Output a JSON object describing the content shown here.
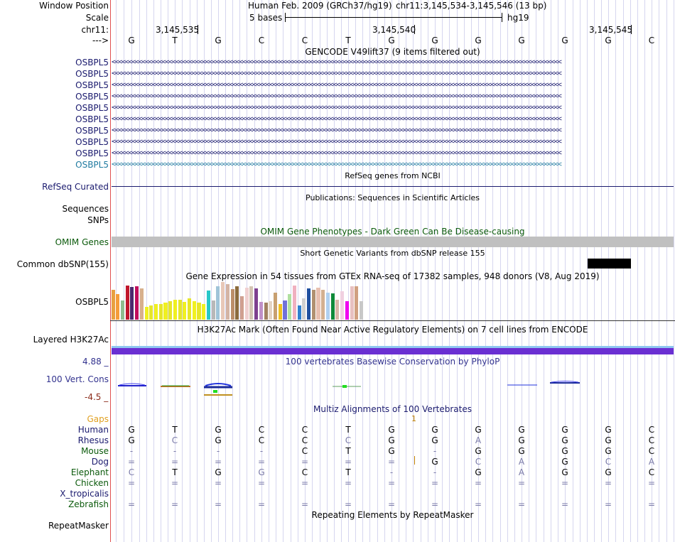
{
  "header": {
    "window_position_label": "Window Position",
    "assembly": "Human Feb. 2009 (GRCh37/hg19)",
    "position": "chr11:3,145,534-3,145,546 (13 bp)",
    "scale_label": "Scale",
    "scale_value": "5 bases",
    "scale_db": "hg19",
    "chrom_label": "chr11:",
    "strand_label": "--->",
    "coords": [
      "3,145,535",
      "3,145,540",
      "3,145,545"
    ]
  },
  "bases": [
    "G",
    "T",
    "G",
    "C",
    "C",
    "T",
    "G",
    "G",
    "G",
    "G",
    "G",
    "G",
    "C"
  ],
  "gencode": {
    "title": "GENCODE V49lift37 (9 items filtered out)",
    "labels": [
      "OSBPL5",
      "OSBPL5",
      "OSBPL5",
      "OSBPL5",
      "OSBPL5",
      "OSBPL5",
      "OSBPL5",
      "OSBPL5",
      "OSBPL5",
      "OSBPL5"
    ],
    "strand_glyph": "<<<<<<<<<<<<<<<<<<<<<<<<<<<<<<<<<<<<<<<<<<<<<<<<<<<<<<<<<<<<<<<<<<<<<<<<<<<<<<<<<<<<<<<<<<<<<<<<<<<<<<<<<<<<<<<<<<<<<<<<<<<<<<<<<<<<<<"
  },
  "refseq": {
    "title": "RefSeq genes from NCBI",
    "label": "RefSeq Curated"
  },
  "publications": {
    "title": "Publications: Sequences in Scientific Articles",
    "label1": "Sequences",
    "label2": "SNPs"
  },
  "omim": {
    "title": "OMIM Gene Phenotypes - Dark Green Can Be Disease-causing",
    "label": "OMIM Genes"
  },
  "dbsnp": {
    "title": "Short Genetic Variants from dbSNP release 155",
    "label": "Common dbSNP(155)"
  },
  "gtex": {
    "title": "Gene Expression in 54 tissues from GTEx RNA-seq of 17382 samples, 948 donors (V8, Aug 2019)",
    "label": "OSBPL5",
    "values": [
      42,
      36,
      27,
      48,
      46,
      47,
      44,
      18,
      20,
      22,
      22,
      24,
      26,
      28,
      28,
      25,
      30,
      26,
      24,
      22,
      41,
      27,
      47,
      53,
      50,
      43,
      47,
      33,
      45,
      47,
      44,
      25,
      24,
      26,
      38,
      22,
      27,
      36,
      48,
      20,
      30,
      44,
      42,
      45,
      42,
      38,
      37,
      28,
      40,
      26,
      47,
      47,
      26
    ],
    "colors": [
      "#e8a040",
      "#f59c3a",
      "#8fbc8f",
      "#c0162d",
      "#4b2a6e",
      "#c00d5d",
      "#d8b08c",
      "#f0f020",
      "#e6e62a",
      "#f0f020",
      "#e6e62a",
      "#f0f020",
      "#e6e62a",
      "#f0f020",
      "#e6e62a",
      "#f0f020",
      "#e6e62a",
      "#f0f020",
      "#e6e62a",
      "#f0f020",
      "#28c8c8",
      "#b8b8b8",
      "#a0c4d8",
      "#e8c8b8",
      "#d4b4a4",
      "#bc8f6a",
      "#8b6b3e",
      "#d0a090",
      "#f0d0d0",
      "#d4c4b4",
      "#7f4090",
      "#c090c8",
      "#a08060",
      "#e4d4c4",
      "#c8a070",
      "#f0c020",
      "#7070d8",
      "#b0e0a0",
      "#f0b0c0",
      "#3080d0",
      "#d0d0d0",
      "#2050a0",
      "#b09070",
      "#e8c0b0",
      "#d4b090",
      "#b0d0f0",
      "#0f8a3a",
      "#d8b8a8",
      "#f0d0e0",
      "#f000f0",
      "#e8c0c0",
      "#d0a080",
      "#c8c8c8"
    ]
  },
  "h3k27ac": {
    "title": "H3K27Ac Mark (Often Found Near Active Regulatory Elements) on 7 cell lines from ENCODE",
    "label": "Layered H3K27Ac"
  },
  "phylop": {
    "title": "100 vertebrates Basewise Conservation by PhyloP",
    "label": "100 Vert. Cons",
    "max": "4.88 _",
    "min": "-4.5 _"
  },
  "multiz": {
    "title": "Multiz Alignments of 100 Vertebrates",
    "gaps_label": "Gaps",
    "gaps_value": "1",
    "species": [
      {
        "name": "Human",
        "bases": [
          "G",
          "T",
          "G",
          "C",
          "C",
          "T",
          "G",
          "G",
          "G",
          "G",
          "G",
          "G",
          "C"
        ]
      },
      {
        "name": "Rhesus",
        "bases": [
          "G",
          "C",
          "G",
          "C",
          "C",
          "C",
          "G",
          "G",
          "A",
          "G",
          "G",
          "G",
          "C"
        ]
      },
      {
        "name": "Mouse",
        "bases": [
          "-",
          "-",
          "-",
          "-",
          "C",
          "T",
          "G",
          "-",
          "G",
          "G",
          "G",
          "G",
          "C"
        ]
      },
      {
        "name": "Dog",
        "bases": [
          "=",
          "=",
          "=",
          "=",
          "=",
          "=",
          "=",
          "G",
          "C",
          "A",
          "G",
          "C",
          "A"
        ]
      },
      {
        "name": "Elephant",
        "bases": [
          "C",
          "T",
          "G",
          "G",
          "C",
          "T",
          "-",
          "-",
          "G",
          "A",
          "G",
          "G",
          "C"
        ]
      },
      {
        "name": "Chicken",
        "bases": [
          "=",
          "=",
          "=",
          "=",
          "=",
          "=",
          "=",
          "=",
          "=",
          "=",
          "=",
          "=",
          "="
        ]
      },
      {
        "name": "X_tropicalis",
        "bases": [
          "",
          "",
          "",
          "",
          "",
          "",
          "",
          "",
          "",
          "",
          "",
          "",
          ""
        ]
      },
      {
        "name": "Zebrafish",
        "bases": [
          "=",
          "=",
          "=",
          "=",
          "=",
          "=",
          "=",
          "=",
          "=",
          "=",
          "=",
          "=",
          "="
        ]
      }
    ]
  },
  "repeatmasker": {
    "title": "Repeating Elements by RepeatMasker",
    "label": "RepeatMasker"
  }
}
